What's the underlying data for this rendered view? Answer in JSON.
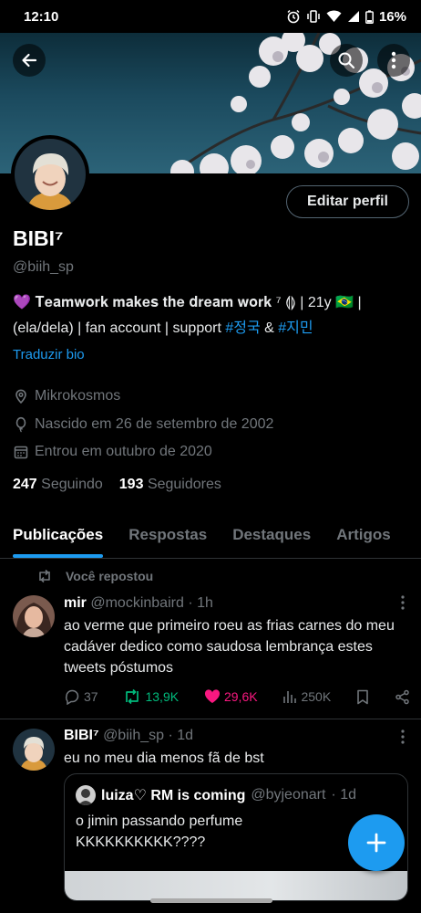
{
  "status_bar": {
    "time": "12:10",
    "battery": "16%"
  },
  "profile": {
    "name": "BIBI⁷",
    "handle": "@biih_sp",
    "edit_button": "Editar perfil",
    "bio_prefix": "💜 𝐓𝐞𝐚𝐦𝐰𝐨𝐫𝐤 𝐦𝐚𝐤𝐞𝐬 𝐭𝐡𝐞 𝐝𝐫𝐞𝐚𝐦 𝐰𝐨𝐫𝐤 ⁷ ⟬⟭ | 21y 🇧🇷 |",
    "bio_line2_prefix": "(ela/dela) | fan account | support ",
    "hashtag1": "#정국",
    "bio_amp": " & ",
    "hashtag2": "#지민",
    "translate_bio": "Traduzir bio",
    "location": "Mikrokosmos",
    "birthday": "Nascido em 26 de setembro de 2002",
    "joined": "Entrou em outubro de 2020",
    "following_count": "247",
    "following_label": "Seguindo",
    "followers_count": "193",
    "followers_label": "Seguidores"
  },
  "tabs": [
    {
      "label": "Publicações",
      "active": true
    },
    {
      "label": "Respostas",
      "active": false
    },
    {
      "label": "Destaques",
      "active": false
    },
    {
      "label": "Artigos",
      "active": false
    }
  ],
  "tweets": [
    {
      "repost_label": "Você repostou",
      "author": "mir",
      "handle": "@mockinbaird",
      "time": "· 1h",
      "text": "ao verme que primeiro roeu as frias carnes do meu cadáver dedico como saudosa lembrança estes tweets póstumos",
      "replies": "37",
      "retweets": "13,9K",
      "likes": "29,6K",
      "views": "250K"
    },
    {
      "author": "BIBI⁷",
      "handle": "@biih_sp",
      "time": "· 1d",
      "text": "eu no meu dia menos fã de bst",
      "quote": {
        "author": "luiza♡ RM is coming",
        "handle": "@byjeonart",
        "time": "· 1d",
        "text": "o jimin passando perfume KKKKKKKKKK????"
      }
    }
  ],
  "colors": {
    "accent": "#1d9bf0",
    "retweet": "#00ba7c",
    "like": "#f91880",
    "background": "#000000"
  }
}
